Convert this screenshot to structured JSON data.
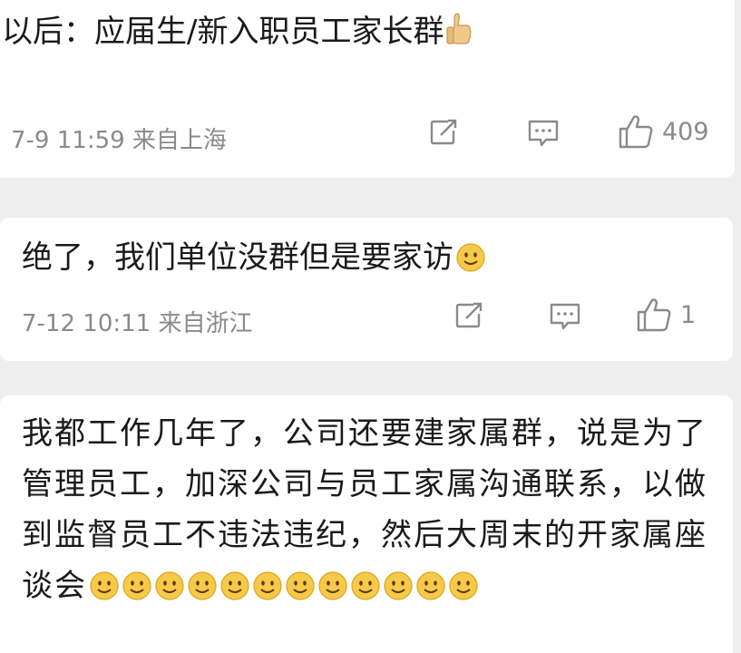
{
  "comments": [
    {
      "text": "以后：应届生/新入职员工家长群",
      "trailing_emoji": "thumbs-up",
      "meta": "7-9 11:59 来自上海",
      "like_count": "409"
    },
    {
      "text": "绝了，我们单位没群但是要家访",
      "trailing_emoji": "smile",
      "meta": "7-12 10:11 来自浙江",
      "like_count": "1"
    },
    {
      "text": "我都工作几年了，公司还要建家属群，说是为了管理员工，加深公司与员工家属沟通联系，以做到监督员工不违法违纪，然后大周末的开家属座谈会",
      "trailing_emoji": "smile",
      "trailing_emoji_count": 12
    }
  ],
  "colors": {
    "background": "#efefef",
    "card": "#ffffff",
    "meta_text": "#8a8a8a",
    "emoji_face": "#f7c948"
  }
}
